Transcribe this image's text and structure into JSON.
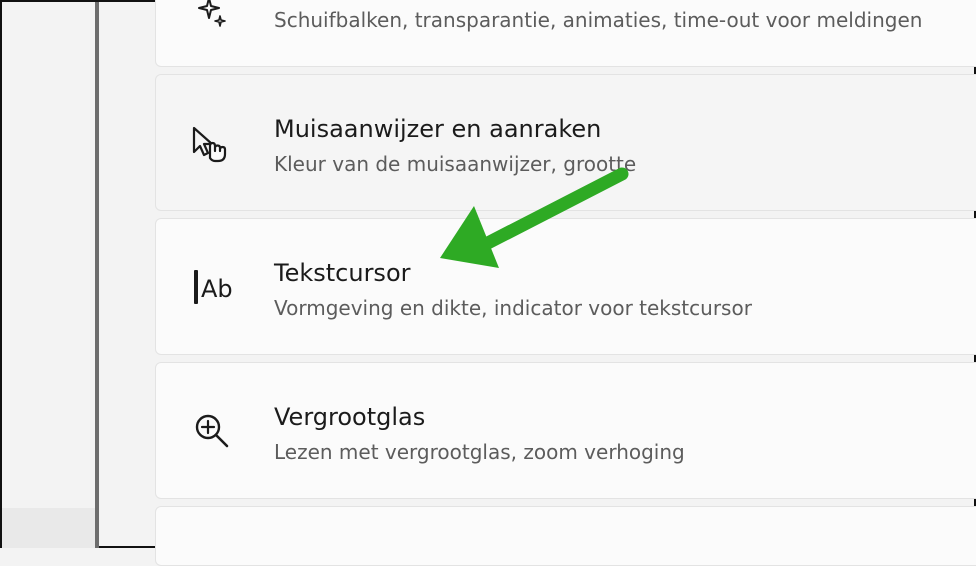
{
  "settings_list": [
    {
      "id": "visual-effects",
      "icon": "sparkle-icon",
      "title": "",
      "subtitle": "Schuifbalken, transparantie, animaties, time-out voor meldingen"
    },
    {
      "id": "mouse-pointer",
      "icon": "pointer-touch-icon",
      "title": "Muisaanwijzer en aanraken",
      "subtitle": "Kleur van de muisaanwijzer, grootte"
    },
    {
      "id": "text-cursor",
      "icon": "text-cursor-icon",
      "title": "Tekstcursor",
      "subtitle": "Vormgeving en dikte, indicator voor tekstcursor"
    },
    {
      "id": "magnifier",
      "icon": "magnifier-icon",
      "title": "Vergrootglas",
      "subtitle": "Lezen met vergrootglas, zoom verhoging"
    }
  ],
  "icon_glyph": {
    "text_cursor_letters": "Ab"
  },
  "annotation": {
    "arrow_color": "#2eaa24"
  }
}
